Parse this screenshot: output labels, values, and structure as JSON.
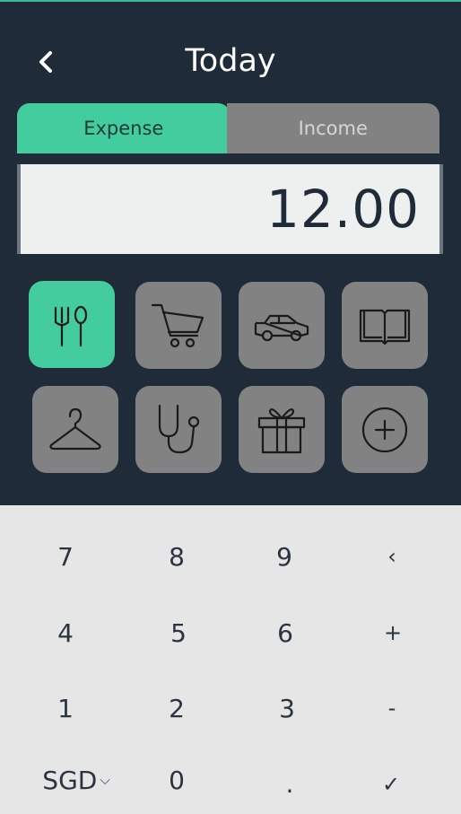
{
  "header": {
    "title": "Today",
    "back_icon": "chevron-left-icon"
  },
  "tabs": {
    "expense": "Expense",
    "income": "Income",
    "selected": "Expense"
  },
  "amount": {
    "value": "12.00"
  },
  "categories": [
    {
      "icon": "food-icon",
      "selected": true
    },
    {
      "icon": "cart-icon",
      "selected": false
    },
    {
      "icon": "car-icon",
      "selected": false
    },
    {
      "icon": "book-icon",
      "selected": false
    },
    {
      "icon": "hanger-icon",
      "selected": false
    },
    {
      "icon": "stethoscope-icon",
      "selected": false
    },
    {
      "icon": "gift-icon",
      "selected": false
    },
    {
      "icon": "add-icon",
      "selected": false
    }
  ],
  "keypad": {
    "k7": "7",
    "k8": "8",
    "k9": "9",
    "backspace": "‹",
    "k4": "4",
    "k5": "5",
    "k6": "6",
    "plus": "+",
    "k1": "1",
    "k2": "2",
    "k3": "3",
    "minus": "-",
    "currency": "SGD",
    "currency_chevron": "⌵",
    "k0": "0",
    "dot": ".",
    "confirm": "✓"
  },
  "colors": {
    "header_bg": "#1f2b38",
    "accent": "#43cc9d",
    "tile_gray": "#828282",
    "keypad_bg": "#e6e6e6"
  }
}
